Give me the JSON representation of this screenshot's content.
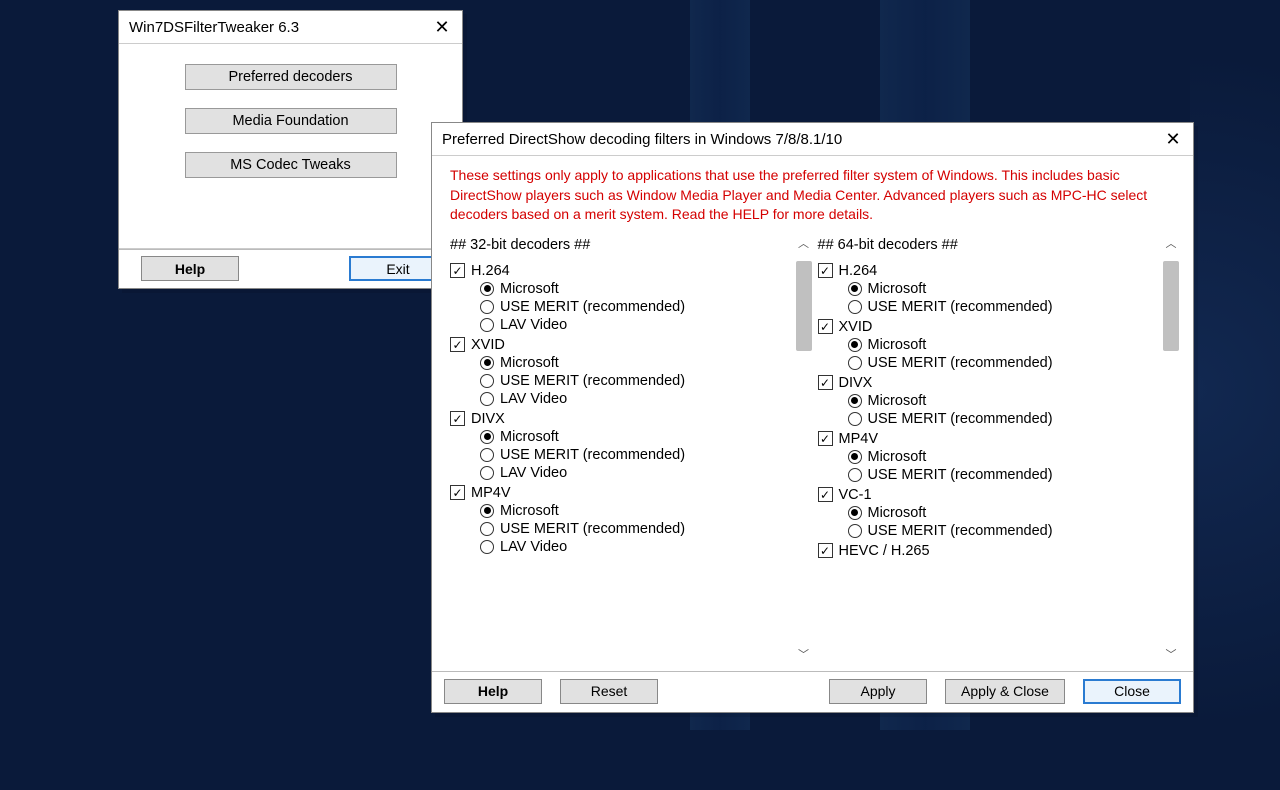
{
  "win1": {
    "title": "Win7DSFilterTweaker 6.3",
    "buttons": [
      "Preferred decoders",
      "Media Foundation",
      "MS Codec Tweaks"
    ],
    "help": "Help",
    "exit": "Exit"
  },
  "win2": {
    "title": "Preferred DirectShow decoding filters in Windows 7/8/8.1/10",
    "warn": "These settings only apply to applications that use the preferred filter system of Windows. This includes basic DirectShow players such as Window Media Player and Media Center. Advanced players such as MPC-HC select decoders based on a merit system. Read the HELP for more details.",
    "h32": "##  32-bit decoders  ##",
    "h64": "##  64-bit decoders  ##",
    "codecs32": [
      {
        "name": "H.264",
        "checked": true,
        "options": [
          {
            "label": "Microsoft",
            "sel": true
          },
          {
            "label": "USE MERIT  (recommended)",
            "sel": false
          },
          {
            "label": "LAV Video",
            "sel": false
          }
        ]
      },
      {
        "name": "XVID",
        "checked": true,
        "options": [
          {
            "label": "Microsoft",
            "sel": true
          },
          {
            "label": "USE MERIT  (recommended)",
            "sel": false
          },
          {
            "label": "LAV Video",
            "sel": false
          }
        ]
      },
      {
        "name": "DIVX",
        "checked": true,
        "options": [
          {
            "label": "Microsoft",
            "sel": true
          },
          {
            "label": "USE MERIT  (recommended)",
            "sel": false
          },
          {
            "label": "LAV Video",
            "sel": false
          }
        ]
      },
      {
        "name": "MP4V",
        "checked": true,
        "options": [
          {
            "label": "Microsoft",
            "sel": true
          },
          {
            "label": "USE MERIT  (recommended)",
            "sel": false
          },
          {
            "label": "LAV Video",
            "sel": false
          }
        ]
      }
    ],
    "codecs64": [
      {
        "name": "H.264",
        "checked": true,
        "options": [
          {
            "label": "Microsoft",
            "sel": true
          },
          {
            "label": "USE MERIT  (recommended)",
            "sel": false
          }
        ]
      },
      {
        "name": "XVID",
        "checked": true,
        "options": [
          {
            "label": "Microsoft",
            "sel": true
          },
          {
            "label": "USE MERIT  (recommended)",
            "sel": false
          }
        ]
      },
      {
        "name": "DIVX",
        "checked": true,
        "options": [
          {
            "label": "Microsoft",
            "sel": true
          },
          {
            "label": "USE MERIT  (recommended)",
            "sel": false
          }
        ]
      },
      {
        "name": "MP4V",
        "checked": true,
        "options": [
          {
            "label": "Microsoft",
            "sel": true
          },
          {
            "label": "USE MERIT  (recommended)",
            "sel": false
          }
        ]
      },
      {
        "name": "VC-1",
        "checked": true,
        "options": [
          {
            "label": "Microsoft",
            "sel": true
          },
          {
            "label": "USE MERIT  (recommended)",
            "sel": false
          }
        ]
      },
      {
        "name": "HEVC / H.265",
        "checked": true,
        "options": []
      }
    ],
    "help": "Help",
    "reset": "Reset",
    "apply": "Apply",
    "applyclose": "Apply & Close",
    "close": "Close"
  }
}
